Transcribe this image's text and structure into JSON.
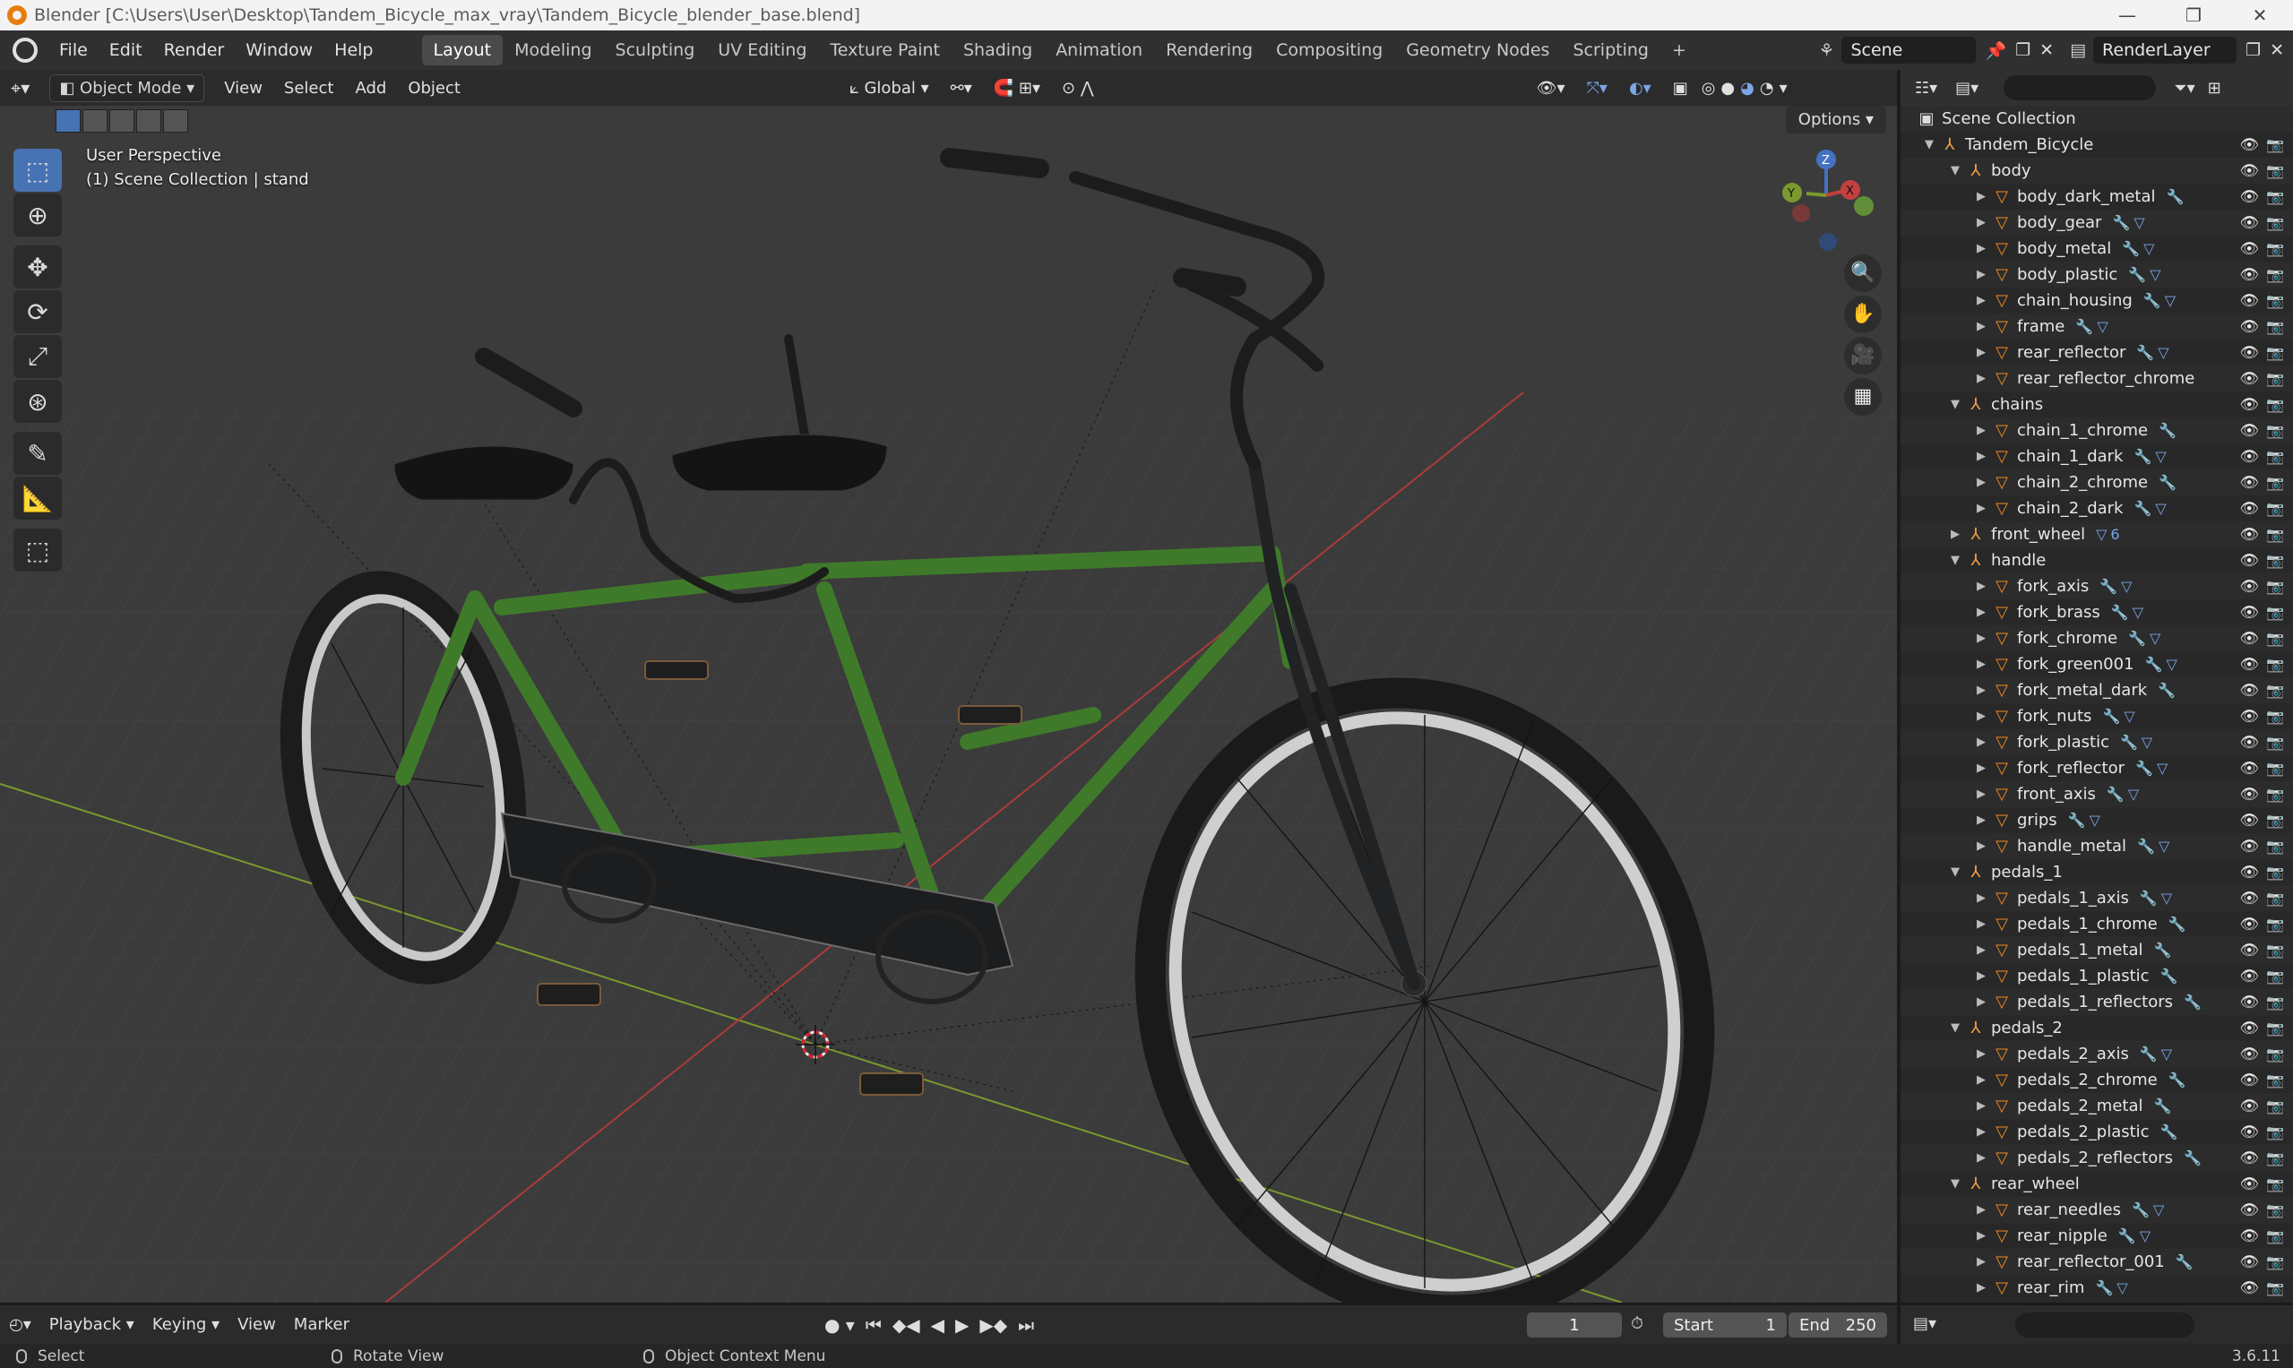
{
  "window": {
    "title": "Blender [C:\\Users\\User\\Desktop\\Tandem_Bicycle_max_vray\\Tandem_Bicycle_blender_base.blend]",
    "buttons": [
      "—",
      "❐",
      "✕"
    ]
  },
  "menu": [
    "File",
    "Edit",
    "Render",
    "Window",
    "Help"
  ],
  "workspaces": [
    "Layout",
    "Modeling",
    "Sculpting",
    "UV Editing",
    "Texture Paint",
    "Shading",
    "Animation",
    "Rendering",
    "Compositing",
    "Geometry Nodes",
    "Scripting",
    "+"
  ],
  "active_workspace": "Layout",
  "scene": {
    "name": "Scene",
    "view_layer": "RenderLayer"
  },
  "viewport_header": {
    "mode": "Object Mode",
    "menus": [
      "View",
      "Select",
      "Add",
      "Object"
    ],
    "transform_orientation": "Global",
    "options_label": "Options"
  },
  "viewport_info": {
    "line1": "User Perspective",
    "line2": "(1) Scene Collection | stand"
  },
  "gizmo": {
    "z": "Z",
    "y": "Y",
    "x": "X"
  },
  "outliner": {
    "root": "Scene Collection",
    "rows": [
      {
        "name": "Tandem_Bicycle",
        "level": 0,
        "type": "empty",
        "expanded": true,
        "mods": ""
      },
      {
        "name": "body",
        "level": 1,
        "type": "empty",
        "expanded": true,
        "mods": ""
      },
      {
        "name": "body_dark_metal",
        "level": 2,
        "type": "mesh",
        "mods": "🔧"
      },
      {
        "name": "body_gear",
        "level": 2,
        "type": "mesh",
        "mods": "🔧▽"
      },
      {
        "name": "body_metal",
        "level": 2,
        "type": "mesh",
        "mods": "🔧▽"
      },
      {
        "name": "body_plastic",
        "level": 2,
        "type": "mesh",
        "mods": "🔧▽"
      },
      {
        "name": "chain_housing",
        "level": 2,
        "type": "mesh",
        "mods": "🔧▽"
      },
      {
        "name": "frame",
        "level": 2,
        "type": "mesh",
        "mods": "🔧▽"
      },
      {
        "name": "rear_reflector",
        "level": 2,
        "type": "mesh",
        "mods": "🔧▽"
      },
      {
        "name": "rear_reflector_chrome",
        "level": 2,
        "type": "mesh",
        "mods": ""
      },
      {
        "name": "chains",
        "level": 1,
        "type": "empty",
        "expanded": true,
        "mods": ""
      },
      {
        "name": "chain_1_chrome",
        "level": 2,
        "type": "mesh",
        "mods": "🔧"
      },
      {
        "name": "chain_1_dark",
        "level": 2,
        "type": "mesh",
        "mods": "🔧▽"
      },
      {
        "name": "chain_2_chrome",
        "level": 2,
        "type": "mesh",
        "mods": "🔧"
      },
      {
        "name": "chain_2_dark",
        "level": 2,
        "type": "mesh",
        "mods": "🔧▽"
      },
      {
        "name": "front_wheel",
        "level": 1,
        "type": "empty",
        "expanded": false,
        "mods": "▽6"
      },
      {
        "name": "handle",
        "level": 1,
        "type": "empty",
        "expanded": true,
        "mods": ""
      },
      {
        "name": "fork_axis",
        "level": 2,
        "type": "mesh",
        "mods": "🔧▽"
      },
      {
        "name": "fork_brass",
        "level": 2,
        "type": "mesh",
        "mods": "🔧▽"
      },
      {
        "name": "fork_chrome",
        "level": 2,
        "type": "mesh",
        "mods": "🔧▽"
      },
      {
        "name": "fork_green001",
        "level": 2,
        "type": "mesh",
        "mods": "🔧▽"
      },
      {
        "name": "fork_metal_dark",
        "level": 2,
        "type": "mesh",
        "mods": "🔧"
      },
      {
        "name": "fork_nuts",
        "level": 2,
        "type": "mesh",
        "mods": "🔧▽"
      },
      {
        "name": "fork_plastic",
        "level": 2,
        "type": "mesh",
        "mods": "🔧▽"
      },
      {
        "name": "fork_reflector",
        "level": 2,
        "type": "mesh",
        "mods": "🔧▽"
      },
      {
        "name": "front_axis",
        "level": 2,
        "type": "mesh",
        "mods": "🔧▽"
      },
      {
        "name": "grips",
        "level": 2,
        "type": "mesh",
        "mods": "🔧▽"
      },
      {
        "name": "handle_metal",
        "level": 2,
        "type": "mesh",
        "mods": "🔧▽"
      },
      {
        "name": "pedals_1",
        "level": 1,
        "type": "empty",
        "expanded": true,
        "mods": ""
      },
      {
        "name": "pedals_1_axis",
        "level": 2,
        "type": "mesh",
        "mods": "🔧▽"
      },
      {
        "name": "pedals_1_chrome",
        "level": 2,
        "type": "mesh",
        "mods": "🔧"
      },
      {
        "name": "pedals_1_metal",
        "level": 2,
        "type": "mesh",
        "mods": "🔧"
      },
      {
        "name": "pedals_1_plastic",
        "level": 2,
        "type": "mesh",
        "mods": "🔧"
      },
      {
        "name": "pedals_1_reflectors",
        "level": 2,
        "type": "mesh",
        "mods": "🔧"
      },
      {
        "name": "pedals_2",
        "level": 1,
        "type": "empty",
        "expanded": true,
        "mods": ""
      },
      {
        "name": "pedals_2_axis",
        "level": 2,
        "type": "mesh",
        "mods": "🔧▽"
      },
      {
        "name": "pedals_2_chrome",
        "level": 2,
        "type": "mesh",
        "mods": "🔧"
      },
      {
        "name": "pedals_2_metal",
        "level": 2,
        "type": "mesh",
        "mods": "🔧"
      },
      {
        "name": "pedals_2_plastic",
        "level": 2,
        "type": "mesh",
        "mods": "🔧"
      },
      {
        "name": "pedals_2_reflectors",
        "level": 2,
        "type": "mesh",
        "mods": "🔧"
      },
      {
        "name": "rear_wheel",
        "level": 1,
        "type": "empty",
        "expanded": true,
        "mods": ""
      },
      {
        "name": "rear_needles",
        "level": 2,
        "type": "mesh",
        "mods": "🔧▽"
      },
      {
        "name": "rear_nipple",
        "level": 2,
        "type": "mesh",
        "mods": "🔧▽"
      },
      {
        "name": "rear_reflector_001",
        "level": 2,
        "type": "mesh",
        "mods": "🔧"
      },
      {
        "name": "rear_rim",
        "level": 2,
        "type": "mesh",
        "mods": "🔧▽"
      }
    ]
  },
  "timeline": {
    "menus": [
      "Playback",
      "Keying",
      "View",
      "Marker"
    ],
    "current_frame": "1",
    "start_label": "Start",
    "start": "1",
    "end_label": "End",
    "end": "250"
  },
  "statusbar": {
    "select": "Select",
    "rotate": "Rotate View",
    "context": "Object Context Menu",
    "version": "3.6.11"
  },
  "colors": {
    "accent": "#4772b3",
    "frame_green": "#3f7a2a",
    "axis_red": "#c24040",
    "axis_green": "#7a9a2f"
  }
}
